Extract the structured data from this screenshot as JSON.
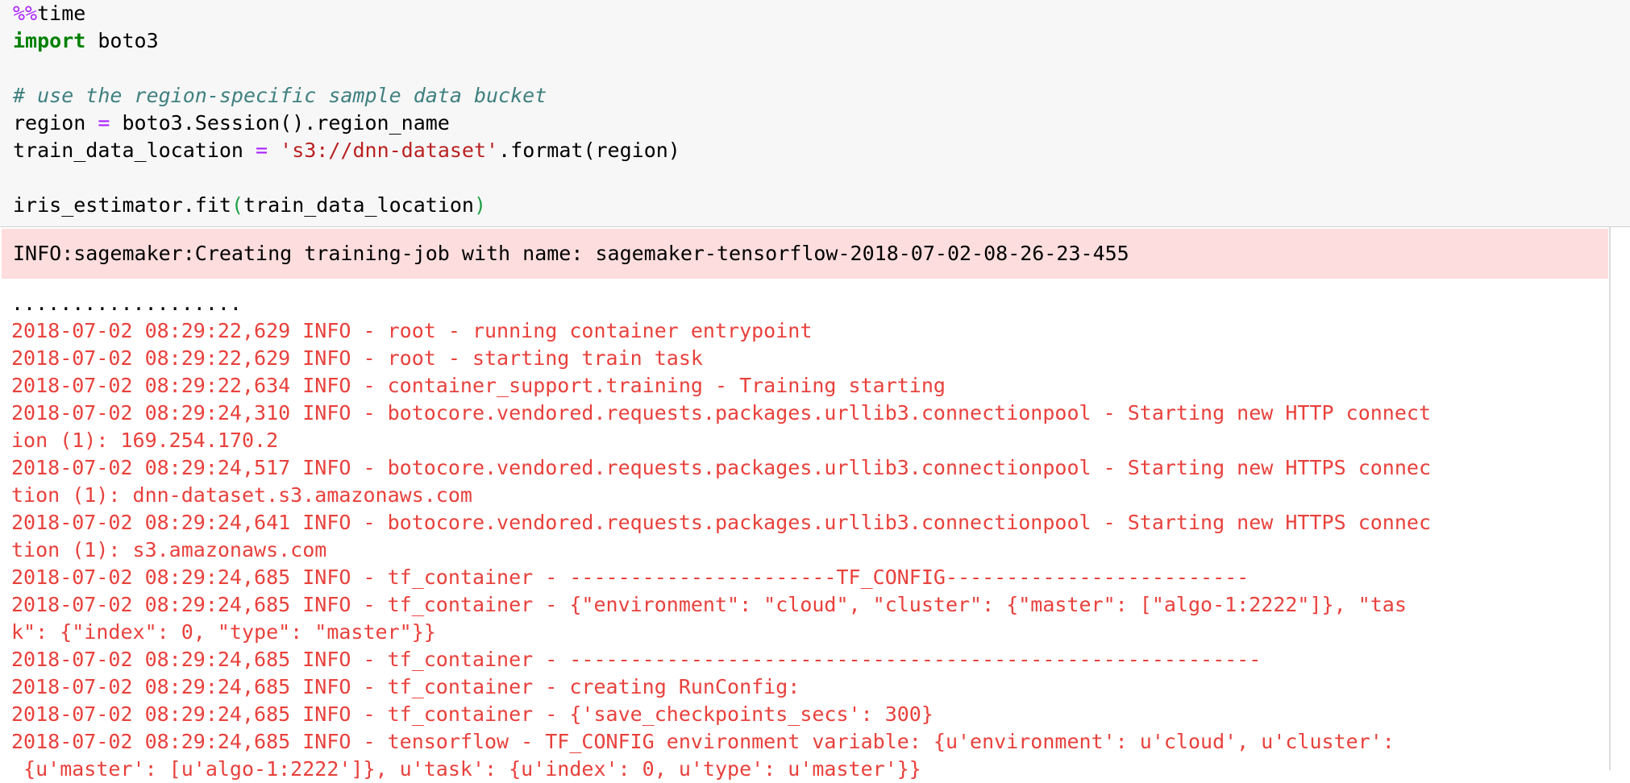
{
  "code": {
    "magic_prefix": "%%",
    "magic_name": "time",
    "import_kw": "import",
    "import_module": " boto3",
    "comment": "# use the region-specific sample data bucket",
    "region_lhs": "region ",
    "region_eq": "=",
    "region_rhs": " boto3.Session().region_name",
    "train_lhs": "train_data_location ",
    "train_eq": "=",
    "train_space": " ",
    "train_str": "'s3://dnn-dataset'",
    "train_rest": ".format(region)",
    "fit_call": "iris_estimator.fit",
    "fit_open": "(",
    "fit_arg": "train_data_location",
    "fit_close": ")"
  },
  "output": {
    "stderr_line": "INFO:sagemaker:Creating training-job with name: sagemaker-tensorflow-2018-07-02-08-26-23-455",
    "progress_dots": "...................",
    "log_lines": [
      "2018-07-02 08:29:22,629 INFO - root - running container entrypoint",
      "2018-07-02 08:29:22,629 INFO - root - starting train task",
      "2018-07-02 08:29:22,634 INFO - container_support.training - Training starting",
      "2018-07-02 08:29:24,310 INFO - botocore.vendored.requests.packages.urllib3.connectionpool - Starting new HTTP connect",
      "ion (1): 169.254.170.2",
      "2018-07-02 08:29:24,517 INFO - botocore.vendored.requests.packages.urllib3.connectionpool - Starting new HTTPS connec",
      "tion (1): dnn-dataset.s3.amazonaws.com",
      "2018-07-02 08:29:24,641 INFO - botocore.vendored.requests.packages.urllib3.connectionpool - Starting new HTTPS connec",
      "tion (1): s3.amazonaws.com",
      "2018-07-02 08:29:24,685 INFO - tf_container - ----------------------TF_CONFIG-------------------------",
      "2018-07-02 08:29:24,685 INFO - tf_container - {\"environment\": \"cloud\", \"cluster\": {\"master\": [\"algo-1:2222\"]}, \"tas",
      "k\": {\"index\": 0, \"type\": \"master\"}}",
      "2018-07-02 08:29:24,685 INFO - tf_container - ---------------------------------------------------------",
      "2018-07-02 08:29:24,685 INFO - tf_container - creating RunConfig:",
      "2018-07-02 08:29:24,685 INFO - tf_container - {'save_checkpoints_secs': 300}",
      "2018-07-02 08:29:24,685 INFO - tensorflow - TF_CONFIG environment variable: {u'environment': u'cloud', u'cluster':",
      " {u'master': [u'algo-1:2222']}, u'task': {u'index': 0, u'type': u'master'}}"
    ]
  }
}
